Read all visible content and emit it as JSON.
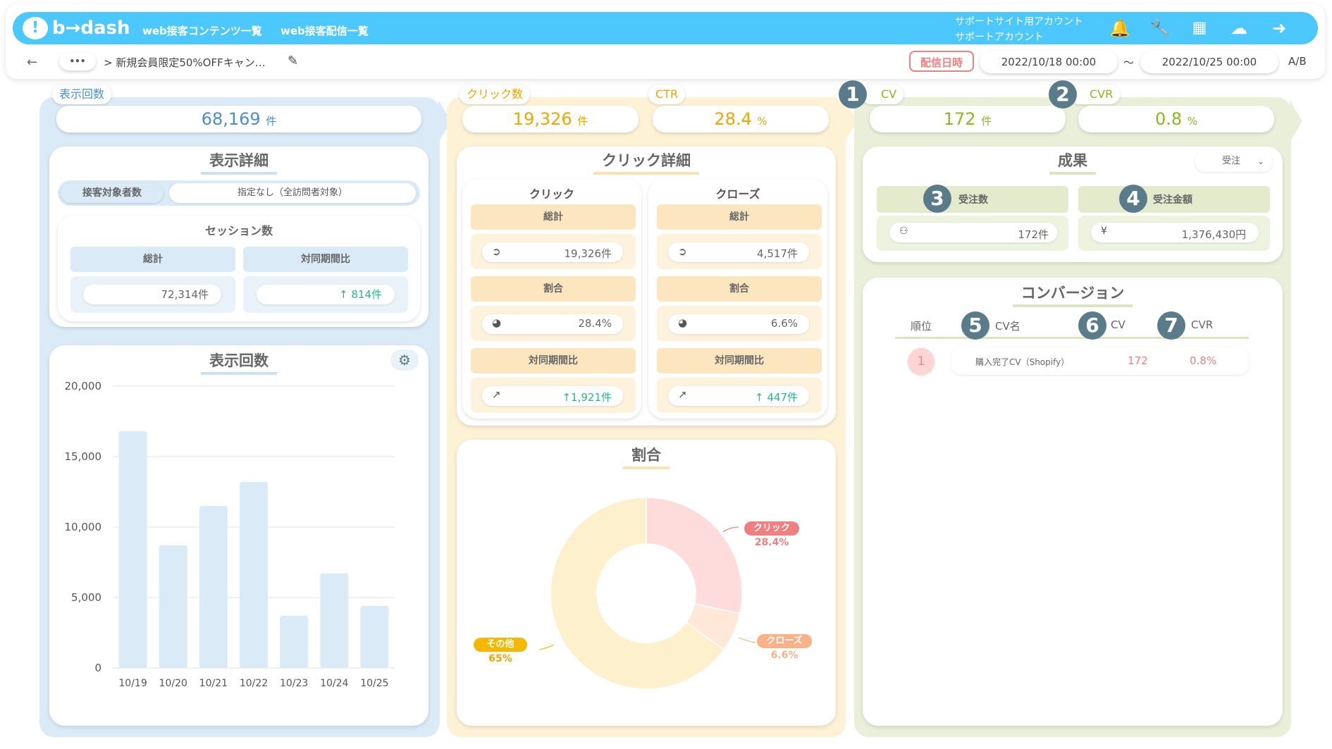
{
  "header": {
    "logo": "b→dash",
    "nav": [
      "web接客コンテンツ一覧",
      "web接客配信一覧"
    ],
    "account_line1": "サポートサイト用アカウント",
    "account_line2": "サポートアカウント",
    "icons": [
      "bell-icon",
      "wrench-icon",
      "apps-grid-icon",
      "chat-bot-icon",
      "logout-icon"
    ]
  },
  "subbar": {
    "back": "←",
    "more": "•••",
    "breadcrumb": "> 新規会員限定50%OFFキャン…",
    "delivery_label": "配信日時",
    "start_date": "2022/10/18 00:00",
    "tilde": "〜",
    "end_date": "2022/10/25 00:00",
    "ab": "A/B"
  },
  "left": {
    "tag": "表示回数",
    "kpi_value": "68,169",
    "kpi_unit": "件",
    "detail_title": "表示詳細",
    "target_label": "接客対象者数",
    "target_value": "指定なし（全訪問者対象）",
    "session_title": "セッション数",
    "total_label": "総計",
    "yoy_label": "対同期間比",
    "total_value": "72,314件",
    "yoy_value": "↑ 814件",
    "chart_title": "表示回数"
  },
  "middle": {
    "click_tag": "クリック数",
    "click_value": "19,326",
    "click_unit": "件",
    "ctr_tag": "CTR",
    "ctr_value": "28.4",
    "ctr_unit": "%",
    "detail_title": "クリック詳細",
    "click_col": {
      "title": "クリック",
      "total_label": "総計",
      "total_value": "19,326件",
      "ratio_label": "割合",
      "ratio_value": "28.4%",
      "yoy_label": "対同期間比",
      "yoy_value": "↑1,921件"
    },
    "close_col": {
      "title": "クローズ",
      "total_label": "総計",
      "total_value": "4,517件",
      "ratio_label": "割合",
      "ratio_value": "6.6%",
      "yoy_label": "対同期間比",
      "yoy_value": "↑ 447件"
    },
    "donut_title": "割合",
    "donut_labels": {
      "click": "クリック",
      "click_pct": "28.4%",
      "close": "クローズ",
      "close_pct": "6.6%",
      "other": "その他",
      "other_pct": "65%"
    }
  },
  "right": {
    "cv_tag": "CV",
    "cv_value": "172",
    "cv_unit": "件",
    "cvr_tag": "CVR",
    "cvr_value": "0.8",
    "cvr_unit": "%",
    "result_title": "成果",
    "select_value": "受注",
    "orders_label": "受注数",
    "orders_value": "172件",
    "amount_label": "受注金額",
    "amount_value": "1,376,430円",
    "conv_title": "コンバージョン",
    "table_headers": [
      "順位",
      "CV名",
      "CV",
      "CVR"
    ],
    "rows": [
      {
        "rank": "1",
        "name": "購入完了CV（Shopify）",
        "cv": "172",
        "cvr": "0.8%"
      }
    ]
  },
  "badges": [
    "1",
    "2",
    "3",
    "4",
    "5",
    "6",
    "7"
  ],
  "colors": {
    "header": "#4cc8ff",
    "blue_col": "#dbeaf7",
    "yellow_col": "#fdf1d6",
    "green_col": "#e9efd9",
    "blue_text": "#4a8fd0",
    "yellow_text": "#f0a500",
    "green_text": "#8ab820",
    "badge": "#5a7c8a"
  },
  "chart_data": [
    {
      "type": "bar",
      "title": "表示回数",
      "categories": [
        "10/19",
        "10/20",
        "10/21",
        "10/22",
        "10/23",
        "10/24",
        "10/25"
      ],
      "values": [
        16800,
        8700,
        11500,
        13200,
        3700,
        6700,
        4400
      ],
      "yticks": [
        "20,000",
        "15,000",
        "10,000",
        "5,000",
        "0"
      ],
      "ylim": [
        0,
        20000
      ],
      "grid": true
    },
    {
      "type": "pie",
      "title": "割合",
      "labels": [
        "クリック",
        "クローズ",
        "その他"
      ],
      "values": [
        28.4,
        6.6,
        65
      ],
      "colors": [
        "#ffdcdc",
        "#ffe8d8",
        "#fdf0cd"
      ]
    }
  ]
}
